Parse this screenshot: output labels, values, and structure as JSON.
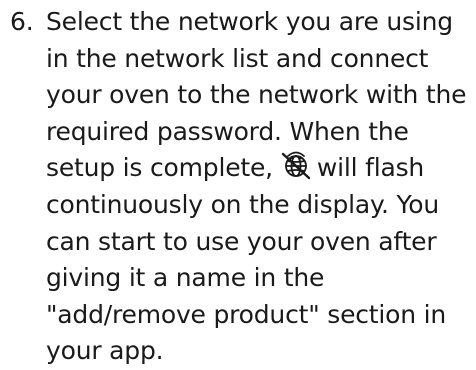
{
  "step": {
    "number": "6.",
    "lines": [
      "Select the network you are using",
      "in the network list and connect",
      "your oven to the network with the",
      "required password. When the",
      "setup is complete,",
      "will flash",
      "continuously on the display. You",
      "can start to use your oven after",
      "giving it a name in the",
      "\"add/remove product\" section in",
      "your app."
    ],
    "icon": "wifi-globe-crossed-icon",
    "text_color": "#1a1a1a"
  }
}
